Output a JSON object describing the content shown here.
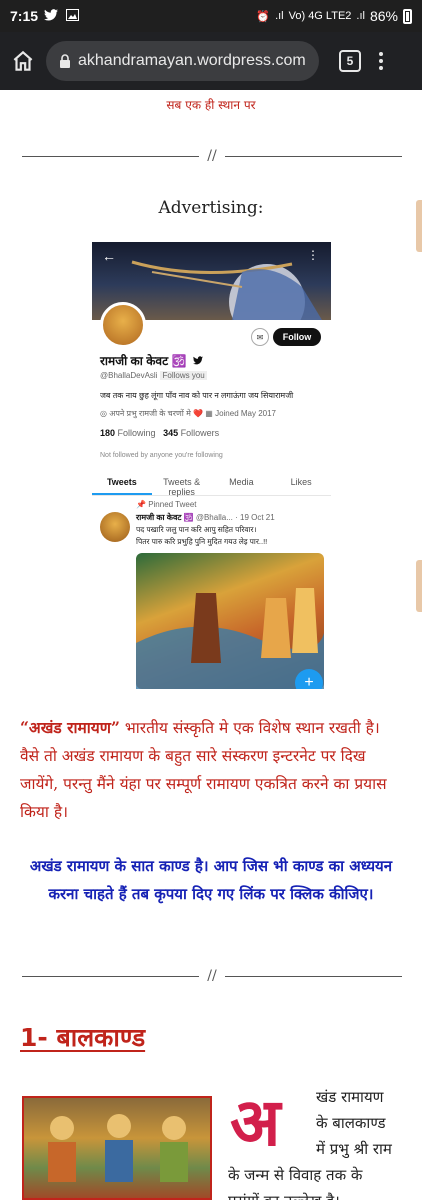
{
  "status_bar": {
    "time": "7:15",
    "battery": "86%",
    "network_labels": "Vo) 4G LTE2"
  },
  "browser": {
    "url": "akhandramayan.wordpress.com",
    "tab_count": "5"
  },
  "page": {
    "tagline": "सब एक ही स्थान पर",
    "separator_mark": "//",
    "advertising_label": "Advertising:",
    "twitter_card": {
      "name": "रामजी का केवट 🕉️",
      "handle": "@BhallaDevAsli",
      "follows_you": "Follows you",
      "follow_button": "Follow",
      "bio": "जब तक नाय छुह लूंगा पाँव नाव को पार न लगाऊंगा  जय सियारामजी",
      "location": "अपने प्रभु रामजी के चरणों मे ❤️",
      "joined": "Joined May 2017",
      "following_count": "180",
      "following_label": "Following",
      "followers_count": "345",
      "followers_label": "Followers",
      "not_followed": "Not followed by anyone you're following",
      "tabs": [
        "Tweets",
        "Tweets & replies",
        "Media",
        "Likes"
      ],
      "pinned_label": "Pinned Tweet",
      "tweet_author": "रामजी का केवट 🕉️",
      "tweet_handle": "@Bhalla...",
      "tweet_date": "· 19 Oct 21",
      "tweet_line1": "पद पखारि जलु पान करि आपु सहित परिवार।",
      "tweet_line2": "पितर पारु करि प्रभुहि पुनि मुदित गयउ लेइ पार..!!"
    },
    "intro_bold": "“अखंड रामायण”",
    "intro_text": " भारतीय संस्कृति मे एक विशेष स्थान रखती है। वैसे तो अखंड रामायण के बहुत सारे संस्करण इन्टरनेट पर दिख जायेंगे, परन्तु मैंने यंहा पर सम्पूर्ण रामायण एकत्रित करने का प्रयास किया है।",
    "kand_intro": "अखंड रामायण के सात काण्ड है। आप जिस भी काण्ड का अध्ययन करना चाहते हैं तब कृपया दिए गए लिंक पर क्लिक कीजिए।",
    "section_title": "1- बालकाण्ड",
    "dropcap": "अ",
    "section_lines": [
      "खंड रामायण",
      "के बालकाण्ड",
      "में प्रभु श्री राम",
      "के जन्म से विवाह तक के",
      "प्रसंगों का उल्लेख है।"
    ]
  },
  "colors": {
    "red": "#c0241b",
    "blue": "#1622b5",
    "dropcap": "#d21f4b",
    "browser_bg": "#202124"
  }
}
